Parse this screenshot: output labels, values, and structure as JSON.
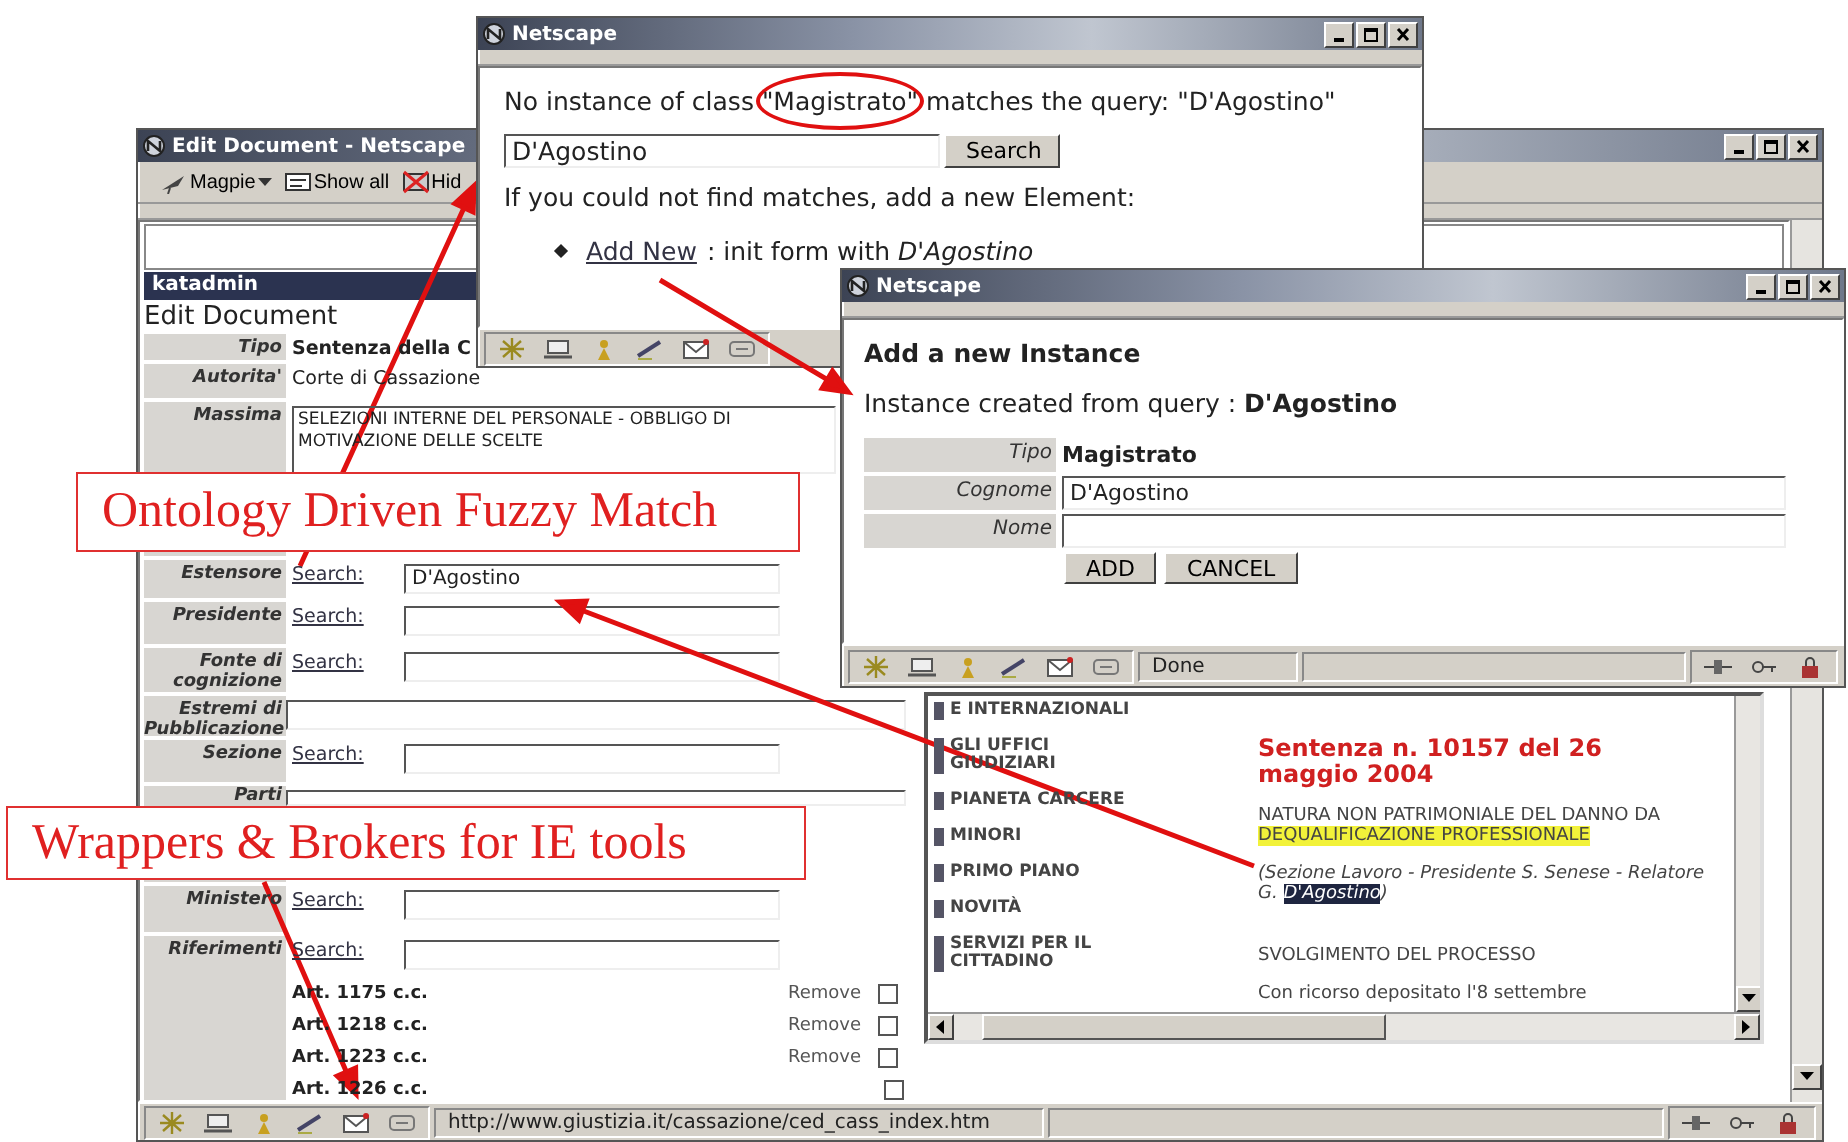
{
  "edit_window": {
    "title": "Edit Document - Netscape",
    "toolbar": [
      {
        "label": "Magpie",
        "kind": "menu"
      },
      {
        "label": "Show all",
        "kind": "button"
      },
      {
        "label": "Hid",
        "kind": "button"
      }
    ],
    "user_bar": "katadmin",
    "heading": "Edit Document",
    "form": [
      {
        "label": "Tipo",
        "kind": "type",
        "value": "Sentenza della C"
      },
      {
        "label": "Autorita'",
        "kind": "text",
        "value": "Corte di Cassazione"
      },
      {
        "label": "Massima",
        "kind": "textarea",
        "value": "SELEZIONI INTERNE DEL PERSONALE - OBBLIGO DI MOTIVAZIONE DELLE SCELTE"
      },
      {
        "kind": "blank"
      },
      {
        "kind": "blank"
      },
      {
        "label": "Estensore",
        "kind": "search",
        "link": "Search:",
        "value": "D'Agostino"
      },
      {
        "label": "Presidente",
        "kind": "search",
        "link": "Search:"
      },
      {
        "label": "Fonte di cognizione",
        "kind": "search",
        "link": "Search:"
      },
      {
        "label": "Estremi di Pubblicazione",
        "kind": "input"
      },
      {
        "label": "Sezione",
        "kind": "search",
        "link": "Search:"
      },
      {
        "label": "Parti",
        "kind": "input"
      },
      {
        "kind": "blank"
      },
      {
        "label": "Ministero",
        "kind": "search",
        "link": "Search:"
      },
      {
        "label": "Riferimenti",
        "kind": "search",
        "link": "Search:",
        "items": [
          {
            "label": "Art. 1175 c.c.",
            "action": "Remove",
            "checked": false
          },
          {
            "label": "Art. 1218 c.c.",
            "action": "Remove",
            "checked": false
          },
          {
            "label": "Art. 1223 c.c.",
            "action": "Remove",
            "checked": false
          },
          {
            "label": "Art. 1226 c.c.",
            "checked": false
          }
        ]
      }
    ],
    "frame": {
      "menu": [
        "E INTERNAZIONALI",
        "GLI UFFICI GIUDIZIARI",
        "PIANETA CARCERE",
        "MINORI",
        "PRIMO PIANO",
        "NOVITÀ",
        "SERVIZI PER IL CITTADINO"
      ],
      "article": {
        "title": "Sentenza n. 10157 del 26 maggio 2004",
        "subject": [
          {
            "text": "NATURA NON PATRIMONIALE DEL DANNO DA ",
            "highlighted": false
          },
          {
            "text": "DEQUALIFICAZIONE PROFESSIONALE",
            "highlighted": true
          }
        ],
        "byline": [
          {
            "text": "(Sezione Lavoro - Presidente S. Senese - Relatore G. ",
            "selected": false
          },
          {
            "text": "D'Agostino",
            "selected": true
          },
          {
            "text": ")",
            "selected": false
          }
        ],
        "section": "SVOLGIMENTO DEL PROCESSO",
        "body": "Con ricorso depositato l'8 settembre"
      }
    },
    "status_url": "http://www.giustizia.it/cassazione/ced_cass_index.htm"
  },
  "search_window": {
    "title": "Netscape",
    "message": [
      {
        "text": "No instance of class ",
        "circled": false
      },
      {
        "text": "\"Magistrato\"",
        "circled": true
      },
      {
        "text": " matches the query: \"D'Agostino\"",
        "circled": false
      }
    ],
    "query": "D'Agostino",
    "button": "Search",
    "hint": "If you could not find matches, add a new Element:",
    "option": {
      "link": "Add New",
      "text": ": init form with *D'Agostino*"
    }
  },
  "add_window": {
    "title": "Netscape",
    "heading": "Add a new Instance",
    "info": "Instance created from query : **D'Agostino**",
    "fields": [
      {
        "label": "Tipo",
        "kind": "type",
        "value": "Magistrato"
      },
      {
        "label": "Cognome",
        "kind": "input",
        "value": "D'Agostino"
      },
      {
        "label": "Nome",
        "kind": "input"
      }
    ],
    "buttons": [
      "ADD",
      "CANCEL"
    ],
    "status": "Done"
  },
  "callouts": [
    {
      "text": "Ontology Driven Fuzzy Match"
    },
    {
      "text": "Wrappers & Brokers for IE tools"
    }
  ]
}
